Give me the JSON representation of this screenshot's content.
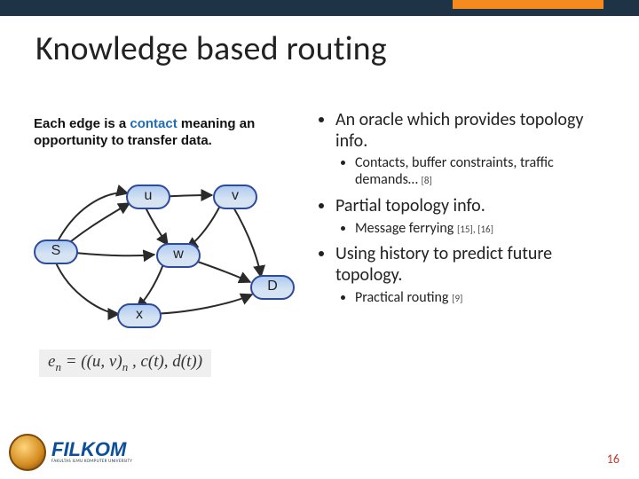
{
  "title": "Knowledge based routing",
  "caption": {
    "pre": "Each edge is a ",
    "highlight": "contact",
    "post": " meaning an opportunity to transfer data."
  },
  "graph": {
    "nodes": {
      "s": "S",
      "u": "u",
      "v": "v",
      "w": "w",
      "x": "x",
      "d": "D"
    }
  },
  "formula": {
    "lhs_e": "e",
    "lhs_sub": "n",
    "rhs": " = ((u, v)",
    "rhs_sub": "n",
    "rhs_tail": " , c(t), d(t))"
  },
  "bullets": {
    "b1": "An oracle which provides topology info.",
    "b1a": "Contacts, buffer constraints, traffic demands… ",
    "b1a_ref": "[8]",
    "b2": "Partial topology info.",
    "b2a": "Message ferrying ",
    "b2a_ref": "[15], [16]",
    "b3": "Using history to predict future topology.",
    "b3a": "Practical routing ",
    "b3a_ref": "[9]"
  },
  "page_number": "16",
  "logo": {
    "main": "FILKOM",
    "sub": "FAKULTAS ILMU KOMPUTER   UNIVERSITY"
  }
}
